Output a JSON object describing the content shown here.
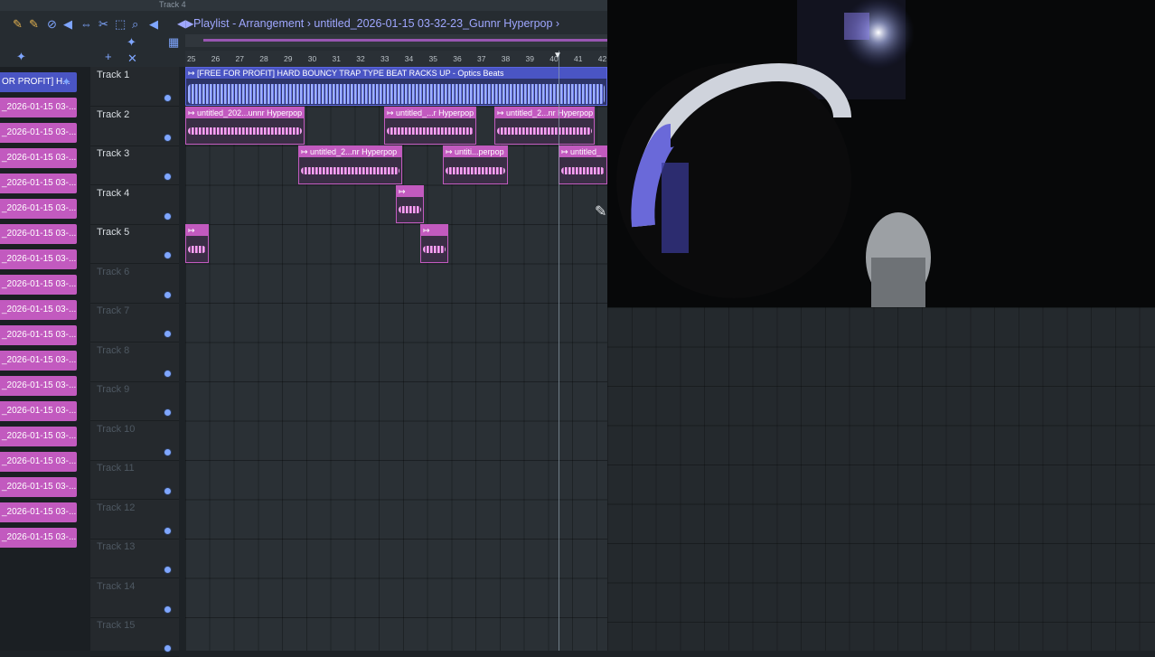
{
  "toolbar": {
    "top_label": "Track 4",
    "title": "Playlist - Arrangement › untitled_2026-01-15 03-32-23_Gunnr Hyperpop ›"
  },
  "ruler": [
    "25",
    "26",
    "27",
    "28",
    "29",
    "30",
    "31",
    "32",
    "33",
    "34",
    "35",
    "36",
    "37",
    "38",
    "39",
    "40",
    "41",
    "42"
  ],
  "picker": {
    "first": "OR PROFIT] H...",
    "item": "_2026-01-15 03-..."
  },
  "tracks": [
    {
      "label": "Track 1",
      "dim": false
    },
    {
      "label": "Track 2",
      "dim": false
    },
    {
      "label": "Track 3",
      "dim": false
    },
    {
      "label": "Track 4",
      "dim": false
    },
    {
      "label": "Track 5",
      "dim": false
    },
    {
      "label": "Track 6",
      "dim": true
    },
    {
      "label": "Track 7",
      "dim": true
    },
    {
      "label": "Track 8",
      "dim": true
    },
    {
      "label": "Track 9",
      "dim": true
    },
    {
      "label": "Track 10",
      "dim": true
    },
    {
      "label": "Track 11",
      "dim": true
    },
    {
      "label": "Track 12",
      "dim": true
    },
    {
      "label": "Track 13",
      "dim": true
    },
    {
      "label": "Track 14",
      "dim": true
    },
    {
      "label": "Track 15",
      "dim": true
    }
  ],
  "clips": {
    "beat": "↦ [FREE FOR PROFIT] HARD BOUNCY TRAP TYPE BEAT RACKS UP - Optics Beats",
    "t2a": "↦ untitled_202...unnr Hyperpop",
    "t2b": "↦ untitled_...r Hyperpop",
    "t2c": "↦ untitled_2...nr Hyperpop",
    "t3a": "↦ untitled_2...nr Hyperpop",
    "t3b": "↦ untiti...perpop",
    "t3c": "↦ untitled_",
    "t4a": "↦",
    "t5a": "↦",
    "t5b": "↦"
  },
  "colors": {
    "accent": "#c25abf",
    "blue": "#4a55c4",
    "bg": "#2a3035"
  }
}
